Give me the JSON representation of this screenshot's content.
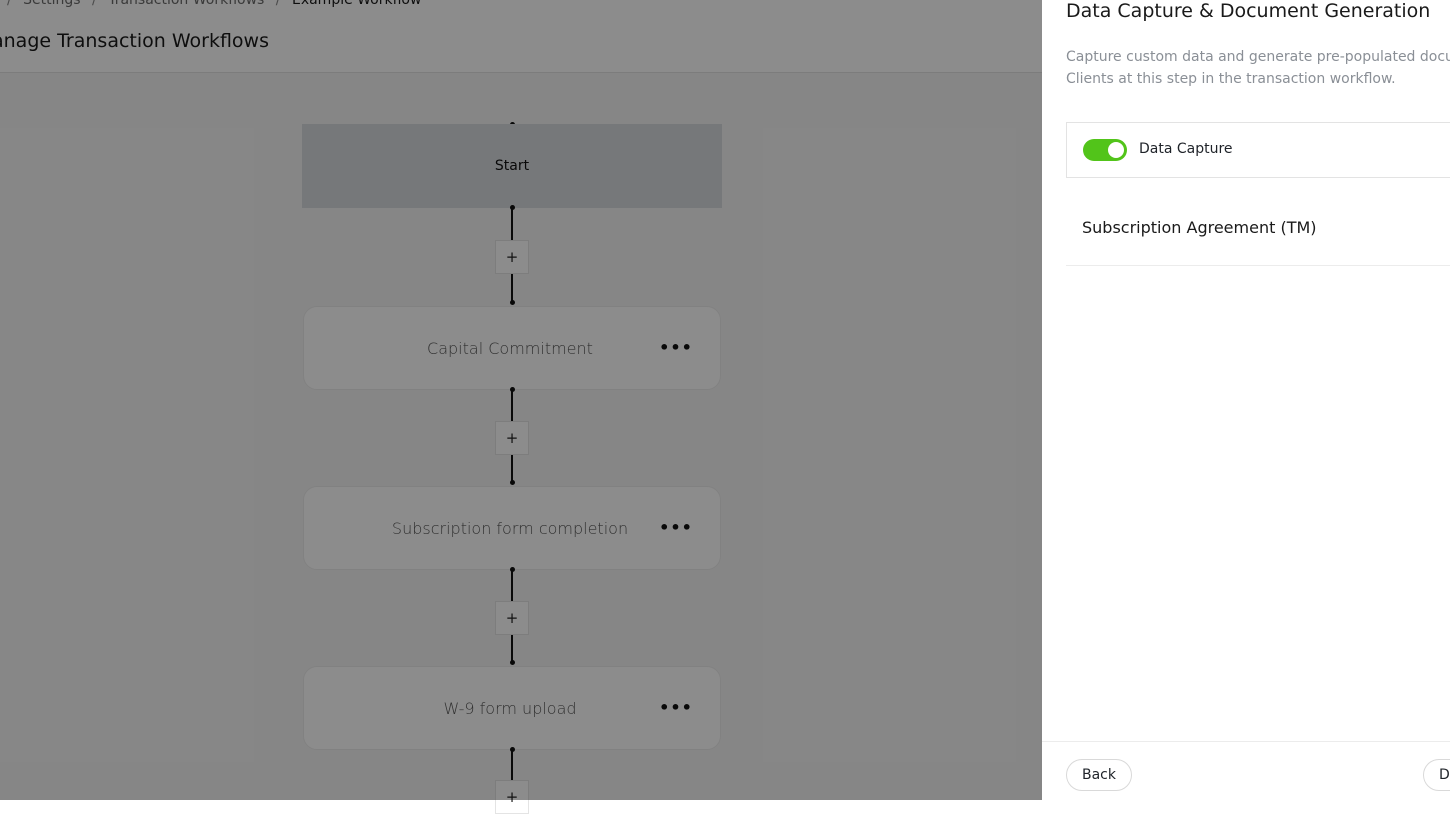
{
  "breadcrumb": {
    "items": [
      "Settings",
      "Transaction Workflows",
      "Example Workflow"
    ],
    "separator": "/"
  },
  "page": {
    "title": "anage Transaction Workflows"
  },
  "workflow": {
    "start_label": "Start",
    "add_label": "+",
    "menu_label": "•••",
    "steps": [
      {
        "label": "Capital Commitment"
      },
      {
        "label": "Subscription form completion"
      },
      {
        "label": "W-9 form upload"
      }
    ]
  },
  "drawer": {
    "title": "Data Capture & Document Generation",
    "description": "Capture custom data and generate pre-populated docume Clients at this step in the transaction workflow.",
    "data_capture": {
      "label": "Data Capture",
      "enabled": true
    },
    "document": {
      "title": "Subscription Agreement (TM)"
    },
    "footer": {
      "back_label": "Back",
      "next_label": "D"
    }
  },
  "colors": {
    "toggle_on": "#52c41a",
    "overlay": "rgba(0,0,0,0.45)",
    "start_node": "#d8dadf"
  }
}
